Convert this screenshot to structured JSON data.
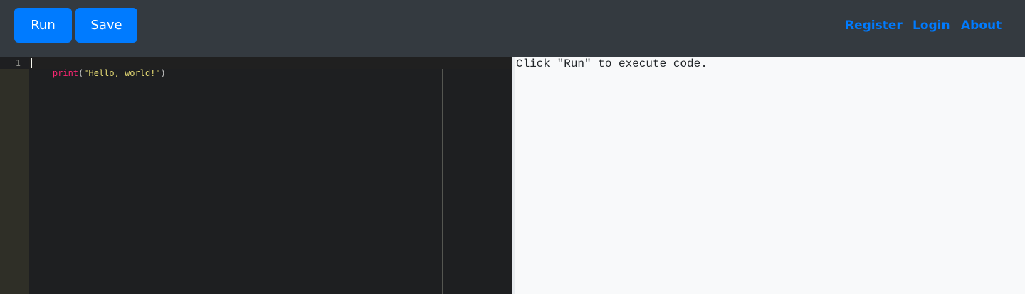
{
  "toolbar": {
    "run_label": "Run",
    "save_label": "Save"
  },
  "nav": {
    "register": "Register",
    "login": "Login",
    "about": "About"
  },
  "editor": {
    "line_number": "1",
    "code": {
      "fn": "print",
      "open_paren": "(",
      "string": "\"Hello, world!\"",
      "close_paren": ")"
    }
  },
  "output": {
    "text": "Click \"Run\" to execute code."
  },
  "colors": {
    "primary": "#007bff",
    "topbar": "#343a40",
    "editor_bg": "#1e1f21",
    "output_bg": "#f8f9fa"
  }
}
